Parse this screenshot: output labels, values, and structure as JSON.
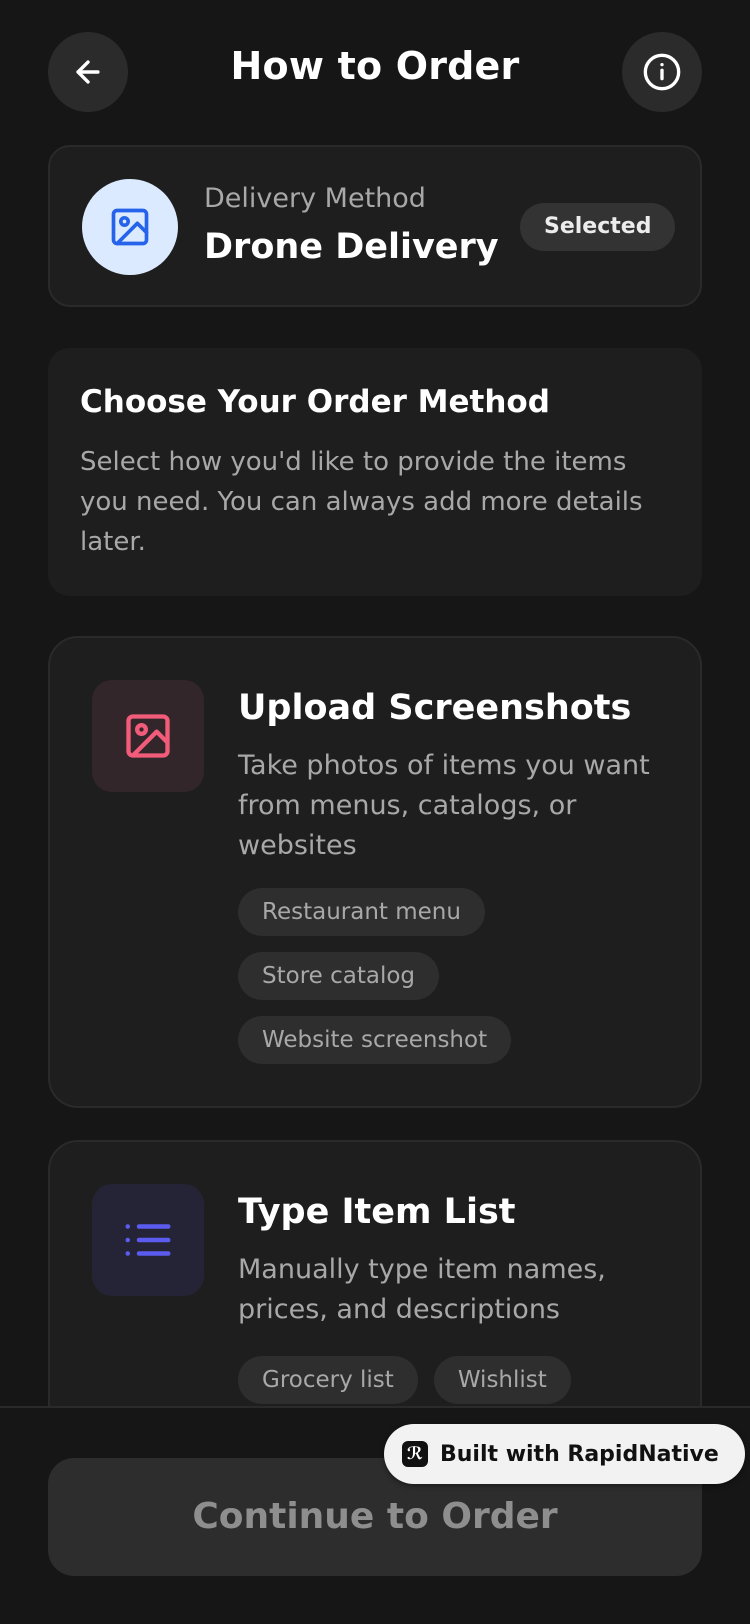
{
  "header": {
    "title": "How to Order"
  },
  "delivery": {
    "label": "Delivery Method",
    "value": "Drone Delivery",
    "badge": "Selected"
  },
  "intro": {
    "title": "Choose Your Order Method",
    "text": "Select how you'd like to provide the items you need. You can always add more details later."
  },
  "options": [
    {
      "icon": "image-icon",
      "title": "Upload Screenshots",
      "description": "Take photos of items you want from menus, catalogs, or websites",
      "tags": [
        "Restaurant menu",
        "Store catalog",
        "Website screenshot"
      ]
    },
    {
      "icon": "list-icon",
      "title": "Type Item List",
      "description": "Manually type item names, prices, and descriptions",
      "tags": [
        "Grocery list",
        "Wishlist"
      ]
    }
  ],
  "footer": {
    "continue_label": "Continue to Order",
    "built_with": "Built with RapidNative"
  },
  "colors": {
    "background": "#161616",
    "card": "#1e1e1e",
    "accent_blue": "#2563eb",
    "accent_pink": "#f25c7a",
    "accent_indigo": "#5b5bf0"
  }
}
